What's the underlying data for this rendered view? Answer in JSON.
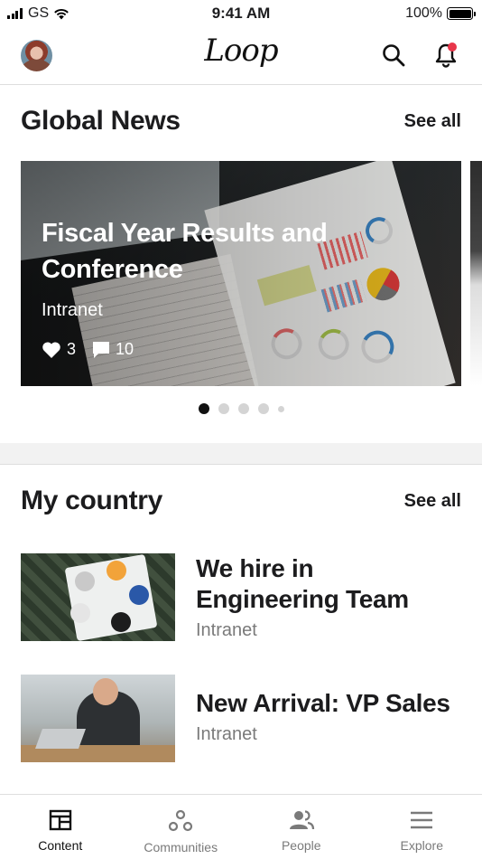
{
  "status_bar": {
    "carrier": "GS",
    "time": "9:41 AM",
    "battery": "100%"
  },
  "header": {
    "logo": "Loop",
    "notification_badge": true
  },
  "global_news": {
    "title": "Global News",
    "see_all": "See all",
    "featured": {
      "title": "Fiscal Year Results and Conference",
      "source": "Intranet",
      "likes": "3",
      "comments": "10"
    },
    "carousel": {
      "pages": 5,
      "active_index": 0
    }
  },
  "my_country": {
    "title": "My country",
    "see_all": "See all",
    "items": [
      {
        "title": "We hire in Engineering Team",
        "source": "Intranet"
      },
      {
        "title": "New Arrival: VP Sales",
        "source": "Intranet"
      }
    ]
  },
  "tab_bar": {
    "tabs": [
      {
        "label": "Content",
        "icon": "content-icon",
        "active": true
      },
      {
        "label": "Communities",
        "icon": "communities-icon",
        "active": false
      },
      {
        "label": "People",
        "icon": "people-icon",
        "active": false
      },
      {
        "label": "Explore",
        "icon": "menu-icon",
        "active": false
      }
    ]
  },
  "colors": {
    "accent_dot": "#e8364a",
    "text": "#1c1c1e",
    "muted": "#7a7a7a"
  }
}
